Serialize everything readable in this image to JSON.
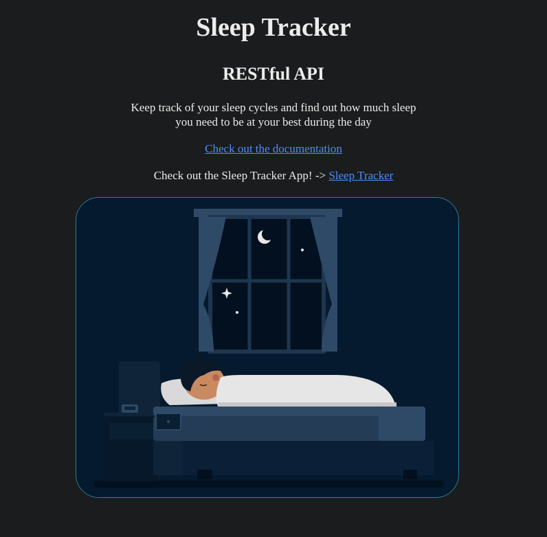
{
  "header": {
    "title": "Sleep Tracker",
    "subtitle": "RESTful API"
  },
  "intro": {
    "description": "Keep track of your sleep cycles and find out how much sleep you need to be at your best during the day",
    "doc_link_label": "Check out the documentation",
    "app_prefix": "Check out the Sleep Tracker App! -> ",
    "app_link_label": "Sleep Tracker"
  },
  "colors": {
    "background": "#1b1c1d",
    "text": "#ececec",
    "link": "#4d8dff",
    "illustration_border": "#2f7f9a",
    "illustration_bg": "#051a2e"
  },
  "illustration": {
    "icons": [
      "moon-icon",
      "star-icon",
      "window",
      "curtain",
      "bed",
      "sleeping-person",
      "nightstand",
      "alarm-clock-icon"
    ]
  }
}
